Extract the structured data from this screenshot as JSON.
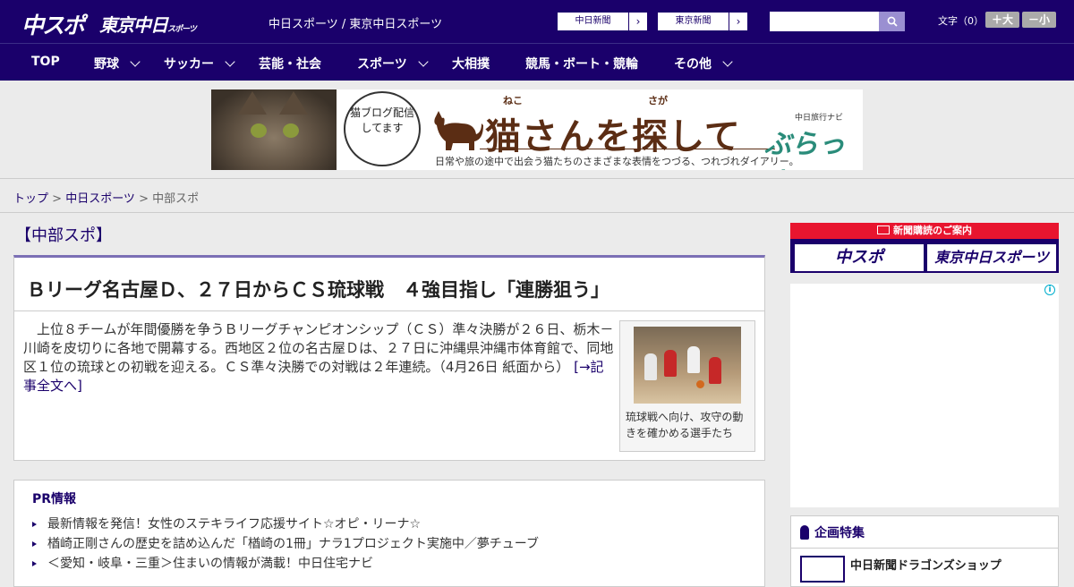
{
  "header": {
    "logo_chu": "中スポ",
    "logo_tokyo": "東京中日",
    "logo_tokyo_small": "スポーツ",
    "site_names": "中日スポーツ / 東京中日スポーツ",
    "paper_links": [
      "中日新聞",
      "東京新聞"
    ],
    "search_placeholder": "",
    "fontsize_label": "文字（0）",
    "fontsize_big": "＋大",
    "fontsize_small": "－小"
  },
  "nav": {
    "items": [
      {
        "label": "TOP",
        "dropdown": false
      },
      {
        "label": "野球",
        "dropdown": true
      },
      {
        "label": "サッカー",
        "dropdown": true
      },
      {
        "label": "芸能・社会",
        "dropdown": false
      },
      {
        "label": "スポーツ",
        "dropdown": true
      },
      {
        "label": "大相撲",
        "dropdown": false
      },
      {
        "label": "競馬・ボート・競輪",
        "dropdown": false
      },
      {
        "label": "その他",
        "dropdown": true
      }
    ]
  },
  "banner": {
    "bubble": "猫ブログ配信してます",
    "title": "猫さんを探して",
    "ruby_neko": "ねこ",
    "ruby_saga": "さが",
    "subtitle": "日常や旅の途中で出会う猫たちのさまざまな表情をつづる、つれづれダイアリー。",
    "brand_small": "中日旅行ナビ",
    "brand": "ぶらっ人"
  },
  "breadcrumb": {
    "top": "トップ",
    "category": "中日スポーツ",
    "current": "中部スポ",
    "sep": " > "
  },
  "section": {
    "title": "【中部スポ】"
  },
  "article": {
    "headline": "Ｂリーグ名古屋Ｄ、２７日からＣＳ琉球戦　４強目指し「連勝狙う」",
    "body": "上位８チームが年間優勝を争うＢリーグチャンピオンシップ（ＣＳ）準々決勝が２６日、栃木－川崎を皮切りに各地で開幕する。西地区２位の名古屋Ｄは、２７日に沖縄県沖縄市体育館で、同地区１位の琉球との初戦を迎える。ＣＳ準々決勝での対戦は２年連続。（4月26日 紙面から）",
    "more_link": "[→記事全文へ]",
    "photo_caption": "琉球戦へ向け、攻守の動きを確かめる選手たち"
  },
  "pr": {
    "title": "PR情報",
    "items": [
      "最新情報を発信！女性のステキライフ応援サイト☆オピ・リーナ☆",
      "楢崎正剛さんの歴史を詰め込んだ「楢崎の1冊」ナラ1プロジェクト実施中／夢チューブ",
      "＜愛知・岐阜・三重＞住まいの情報が満載！中日住宅ナビ"
    ]
  },
  "sidebar": {
    "subscription_head": "新聞購読のご案内",
    "sub_logo_a": "中スポ",
    "sub_logo_b": "東京中日スポーツ",
    "ad_info": "i",
    "feature_title": "企画特集",
    "feature_item": "中日新聞ドラゴンズショップ"
  },
  "colors": {
    "brand_navy": "#1a006b",
    "accent_red": "#e8152f",
    "background": "#ebebeb"
  }
}
